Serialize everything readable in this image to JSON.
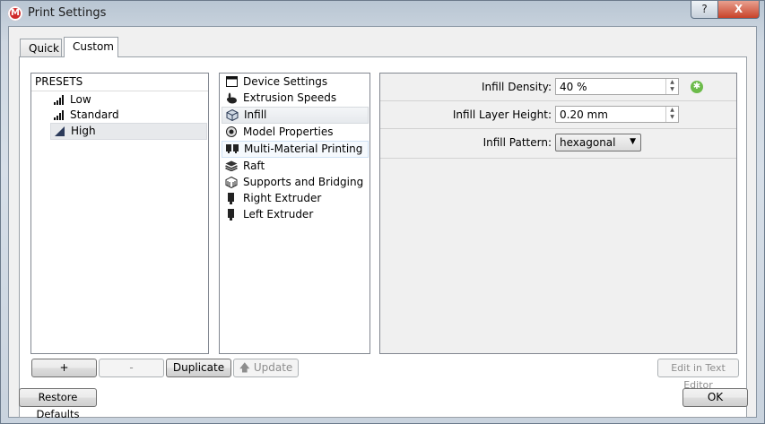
{
  "window": {
    "title": "Print Settings",
    "help_label": "?",
    "close_label": "X",
    "app_icon": "makerbot-logo-icon"
  },
  "tabs": [
    {
      "label": "Quick"
    },
    {
      "label": "Custom"
    }
  ],
  "presets": {
    "header": "PRESETS",
    "items": [
      {
        "label": "Low",
        "icon": "signal-bars-icon"
      },
      {
        "label": "Standard",
        "icon": "signal-bars-icon"
      },
      {
        "label": "High",
        "icon": "wedge-icon"
      }
    ],
    "selected": "High"
  },
  "categories": {
    "items": [
      {
        "label": "Device Settings",
        "icon": "window-icon"
      },
      {
        "label": "Extrusion Speeds",
        "icon": "rabbit-icon"
      },
      {
        "label": "Infill",
        "icon": "honeycomb-cube-icon"
      },
      {
        "label": "Model Properties",
        "icon": "eye-icon"
      },
      {
        "label": "Multi-Material Printing",
        "icon": "dual-extruder-icon"
      },
      {
        "label": "Raft",
        "icon": "layers-icon"
      },
      {
        "label": "Supports and Bridging",
        "icon": "support-cube-icon"
      },
      {
        "label": "Right Extruder",
        "icon": "extruder-icon"
      },
      {
        "label": "Left Extruder",
        "icon": "extruder-icon"
      }
    ],
    "selected": "Infill"
  },
  "settings": {
    "infill_density": {
      "label": "Infill Density:",
      "value": "40 %"
    },
    "infill_layer_height": {
      "label": "Infill Layer Height:",
      "value": "0.20 mm"
    },
    "infill_pattern": {
      "label": "Infill Pattern:",
      "value": "hexagonal"
    }
  },
  "buttons": {
    "add": "+",
    "remove": "-",
    "duplicate": "Duplicate",
    "update": "Update",
    "edit_text": "Edit in Text Editor",
    "restore": "Restore Defaults",
    "ok": "OK"
  }
}
